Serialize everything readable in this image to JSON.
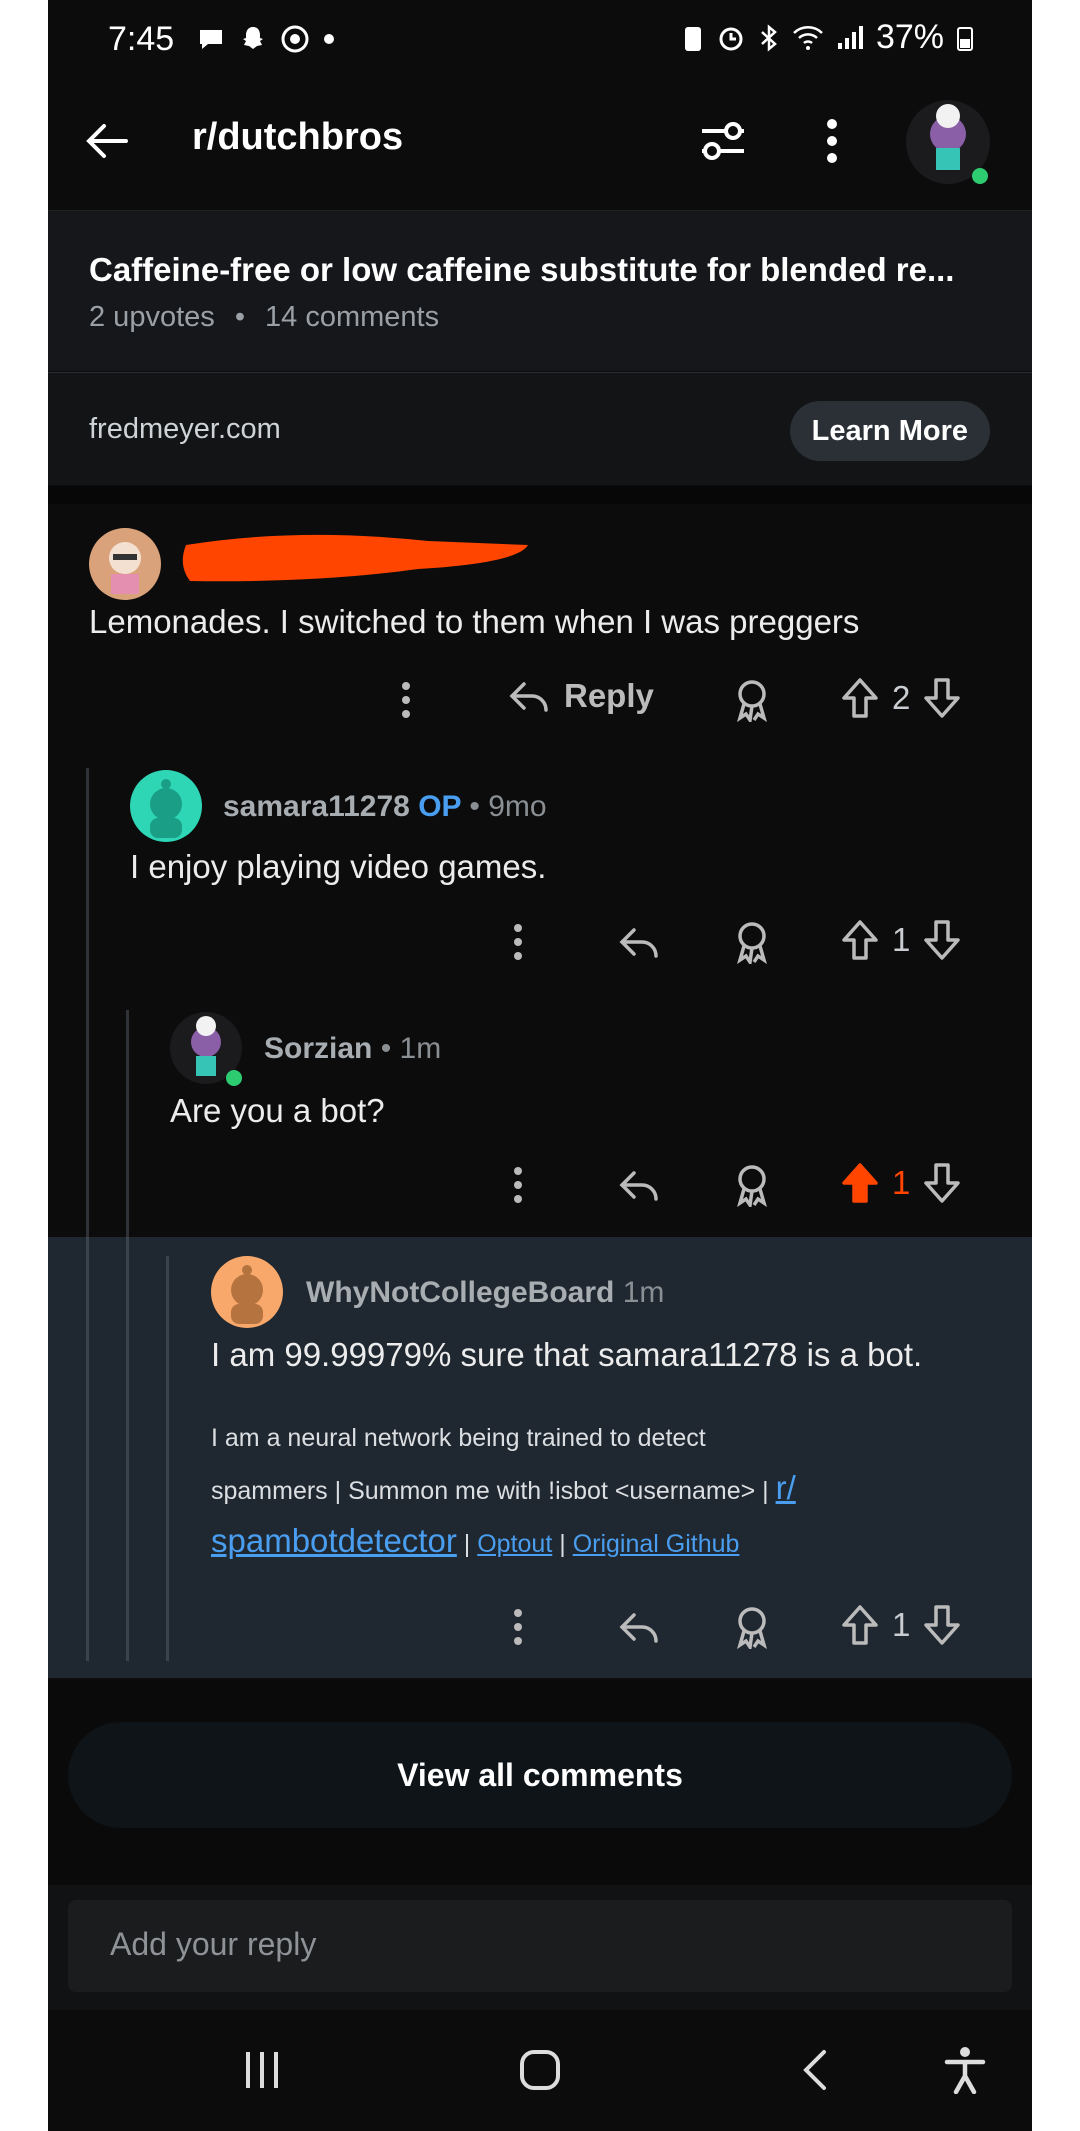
{
  "status_bar": {
    "time": "7:45",
    "battery": "37%"
  },
  "header": {
    "subreddit": "r/dutchbros"
  },
  "post": {
    "title": "Caffeine-free or low caffeine substitute for blended re...",
    "upvotes": "2 upvotes",
    "separator": "•",
    "comments": "14 comments"
  },
  "ad": {
    "domain": "fredmeyer.com",
    "cta": "Learn More"
  },
  "comments": [
    {
      "username": "",
      "text": "Lemonades. I switched to them when I was preggers",
      "reply_label": "Reply",
      "votes": "2"
    },
    {
      "username": "samara11278",
      "op": "OP",
      "time": "• 9mo",
      "text": "I enjoy playing video games.",
      "votes": "1"
    },
    {
      "username": "Sorzian",
      "time": "• 1m",
      "text": "Are you a bot?",
      "votes": "1"
    },
    {
      "username": "WhyNotCollegeBoard",
      "time": "1m",
      "text": "I am 99.99979% sure that samara11278 is a bot.",
      "note_line1": "I am a neural network being trained to detect",
      "note_line2": "spammers | Summon me with !isbot <username> |",
      "link_r": "r/",
      "link_spam": "spambotdetector",
      "sep": "|",
      "link_optout": "Optout",
      "link_github": "Original Github",
      "votes": "1"
    }
  ],
  "view_all": "View all comments",
  "reply_box": {
    "placeholder": "Add your reply"
  },
  "colors": {
    "background": "#0c0c0d",
    "accent_upvote": "#ff4500",
    "link": "#4a9ef0",
    "highlight": "#1f2730"
  }
}
